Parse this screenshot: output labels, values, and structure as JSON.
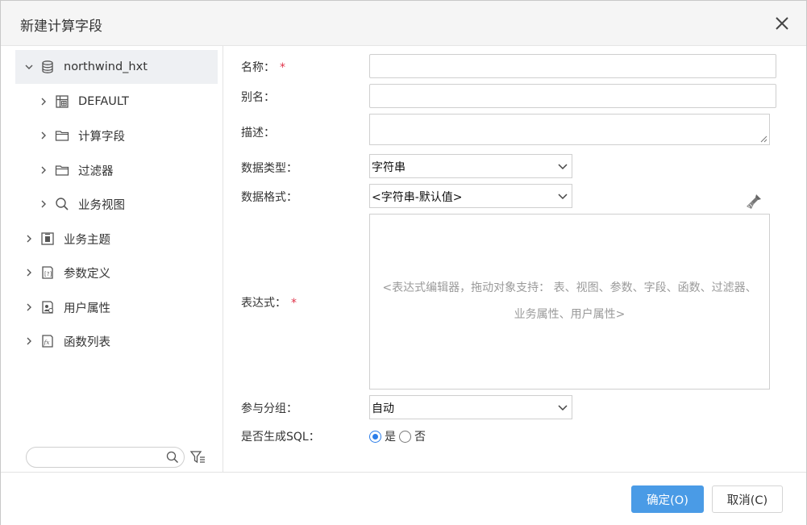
{
  "dialog": {
    "title": "新建计算字段"
  },
  "tree": {
    "root": {
      "label": "northwind_hxt",
      "icon": "database-icon",
      "expanded": true
    },
    "children": [
      {
        "label": "DEFAULT",
        "icon": "schema-grid-icon"
      },
      {
        "label": "计算字段",
        "icon": "folder-icon"
      },
      {
        "label": "过滤器",
        "icon": "folder-icon"
      },
      {
        "label": "业务视图",
        "icon": "search-icon"
      }
    ],
    "siblings": [
      {
        "label": "业务主题",
        "icon": "business-theme-icon"
      },
      {
        "label": "参数定义",
        "icon": "parameter-icon"
      },
      {
        "label": "用户属性",
        "icon": "user-attribute-icon"
      },
      {
        "label": "函数列表",
        "icon": "function-list-icon"
      }
    ],
    "search_placeholder": ""
  },
  "form": {
    "name_label": "名称：",
    "alias_label": "别名：",
    "desc_label": "描述：",
    "datatype_label": "数据类型：",
    "datatype_value": "字符串",
    "format_label": "数据格式：",
    "format_value": "<字符串-默认值>",
    "expr_label": "表达式：",
    "expr_placeholder": "<表达式编辑器，拖动对象支持： 表、视图、参数、字段、函数、过滤器、业务属性、用户属性>",
    "group_label": "参与分组：",
    "group_value": "自动",
    "sql_label": "是否生成SQL：",
    "sql_yes": "是",
    "sql_no": "否",
    "sql_selected": "是",
    "required_mark": "*"
  },
  "footer": {
    "ok_label": "确定(O)",
    "cancel_label": "取消(C)"
  },
  "colors": {
    "primary": "#4a9be6",
    "required": "#e0334a",
    "selected_row": "#eef0f3"
  }
}
